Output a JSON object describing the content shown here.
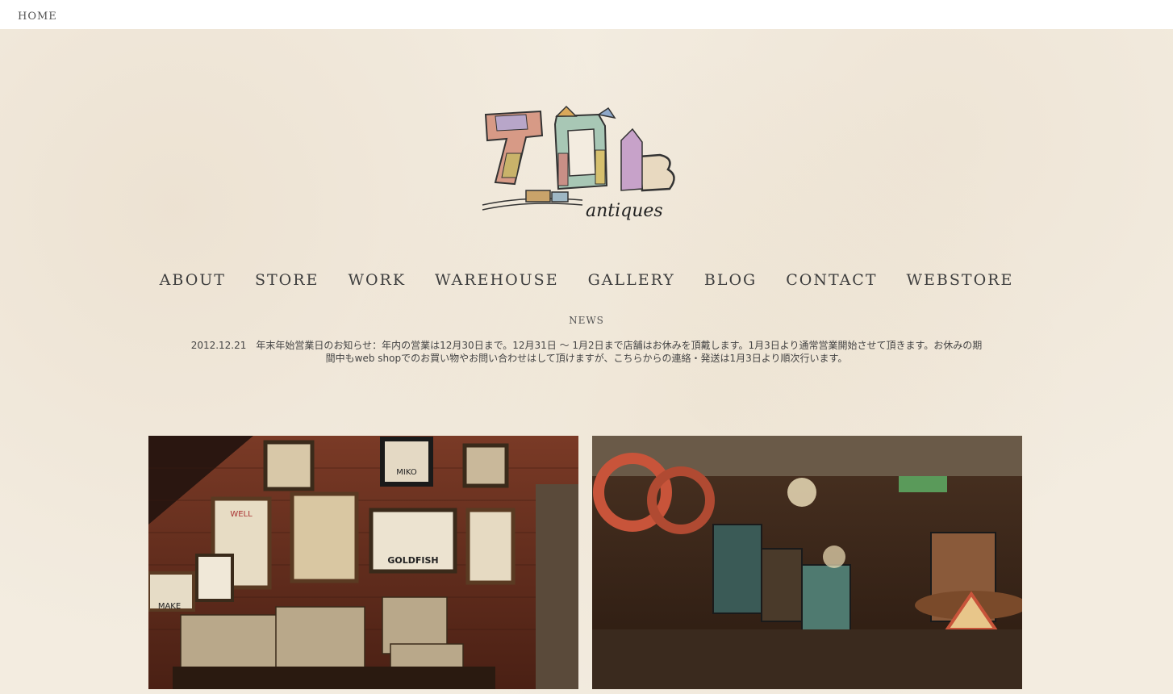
{
  "topbar": {
    "home_label": "HOME"
  },
  "logo": {
    "number": "70",
    "letter": "B",
    "script": "antiques"
  },
  "nav": {
    "items": [
      {
        "label": "ABOUT"
      },
      {
        "label": "STORE"
      },
      {
        "label": "WORK"
      },
      {
        "label": "WAREHOUSE"
      },
      {
        "label": "GALLERY"
      },
      {
        "label": "BLOG"
      },
      {
        "label": "CONTACT"
      },
      {
        "label": "WEBSTORE"
      }
    ]
  },
  "news": {
    "label": "NEWS",
    "text": "2012.12.21　年末年始営業日のお知らせ：年内の営業は12月30日まで。12月31日 ～ 1月2日まで店舗はお休みを頂戴します。1月3日より通常営業開始させて頂きます。お休みの期間中もweb shopでのお買い物やお問い合わせはして頂けますが、こちらからの連絡・発送は1月3日より順次行います。"
  },
  "photos": {
    "left": {
      "signs": [
        "MIKO",
        "GOLDFISH",
        "WELL",
        "MAKE"
      ]
    },
    "right": {
      "signs": []
    }
  },
  "colors": {
    "background": "#f3ece0",
    "topbar": "#ffffff",
    "text": "#3d3d3d"
  }
}
